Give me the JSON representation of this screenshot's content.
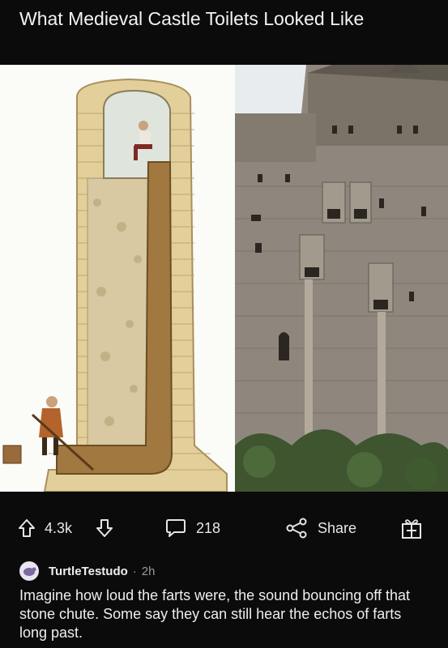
{
  "post": {
    "title": "What Medieval Castle Toilets Looked Like"
  },
  "actions": {
    "upvote_icon": "arrow-up-icon",
    "vote_count": "4.3k",
    "downvote_icon": "arrow-down-icon",
    "comment_icon": "speech-bubble-icon",
    "comment_count": "218",
    "share_icon": "share-icon",
    "share_label": "Share",
    "award_icon": "gift-icon"
  },
  "comment": {
    "username": "TurtleTestudo",
    "separator": "·",
    "time": "2h",
    "text": "Imagine how loud the farts were, the sound bouncing off that stone chute. Some say they can still hear the echos of farts long past."
  },
  "colors": {
    "background": "#0b0b0b",
    "text": "#ffffff",
    "muted": "#9a9a9a"
  }
}
